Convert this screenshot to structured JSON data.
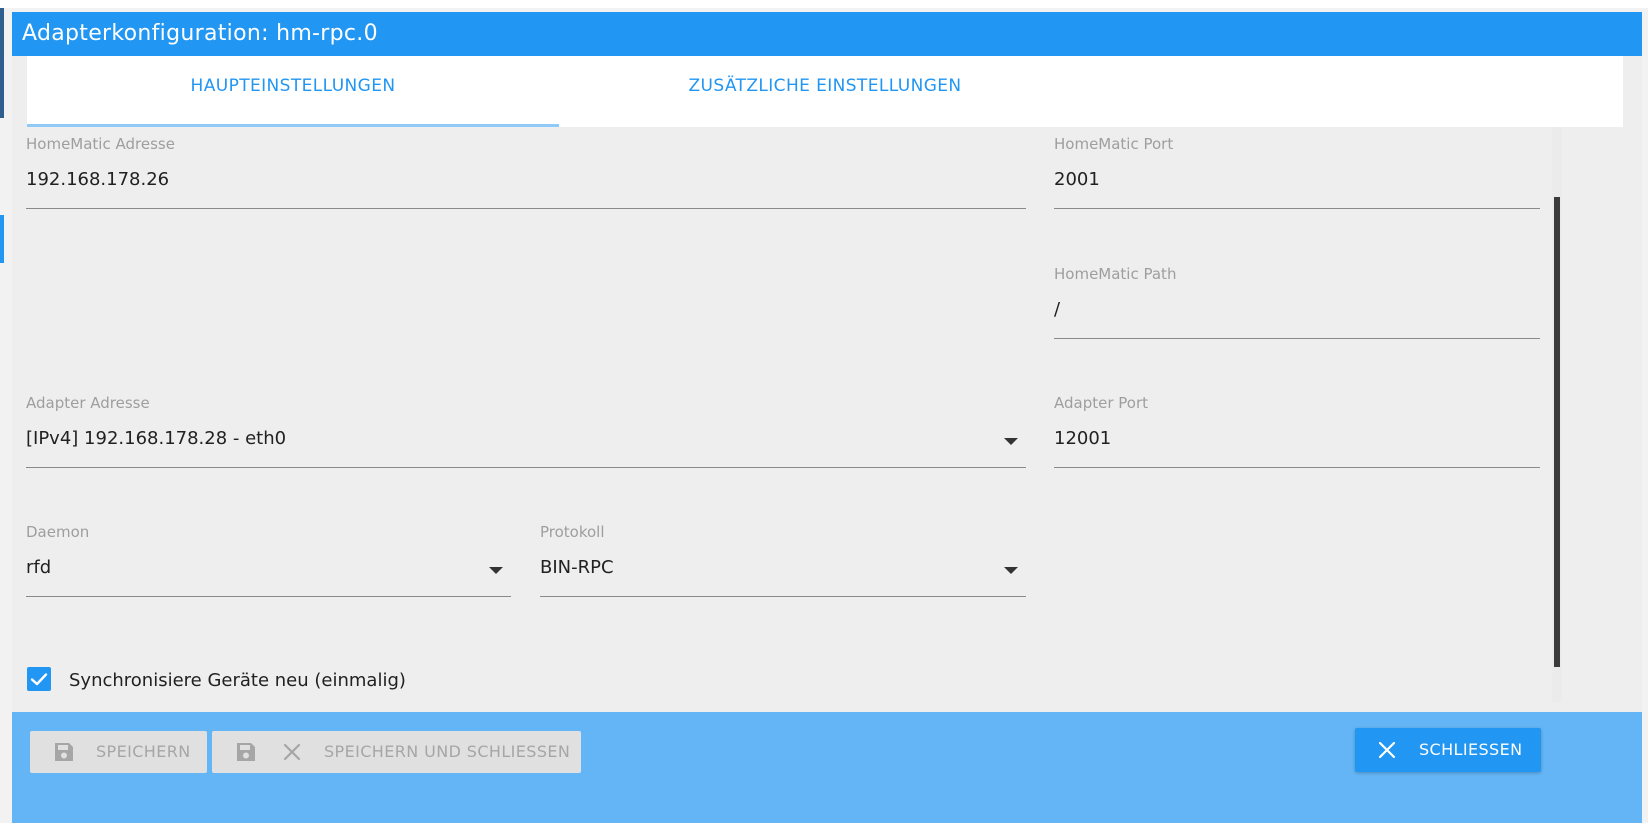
{
  "window": {
    "title": "Adapterkonfiguration: hm-rpc.0"
  },
  "tabs": [
    {
      "label": "HAUPTEINSTELLUNGEN",
      "active": true
    },
    {
      "label": "ZUSÄTZLICHE EINSTELLUNGEN",
      "active": false
    }
  ],
  "fields": {
    "homematic_address": {
      "label": "HomeMatic Adresse",
      "value": "192.168.178.26"
    },
    "homematic_port": {
      "label": "HomeMatic Port",
      "value": "2001"
    },
    "homematic_path": {
      "label": "HomeMatic Path",
      "value": "/"
    },
    "adapter_address": {
      "label": "Adapter Adresse",
      "value": "[IPv4] 192.168.178.28 - eth0"
    },
    "adapter_port": {
      "label": "Adapter Port",
      "value": "12001"
    },
    "daemon": {
      "label": "Daemon",
      "value": "rfd"
    },
    "protocol": {
      "label": "Protokoll",
      "value": "BIN-RPC"
    }
  },
  "sync_checkbox": {
    "label": "Synchronisiere Geräte neu (einmalig)",
    "checked": true
  },
  "footer": {
    "save_label": "SPEICHERN",
    "save_close_label": "SPEICHERN UND SCHLIESSEN",
    "close_label": "SCHLIESSEN"
  },
  "icons": {
    "save": "save-icon",
    "close": "close-icon",
    "dropdown": "chevron-down-icon",
    "check": "check-icon"
  },
  "colors": {
    "primary": "#2196f3",
    "footer": "#64b5f6",
    "background": "#eeeeee"
  }
}
